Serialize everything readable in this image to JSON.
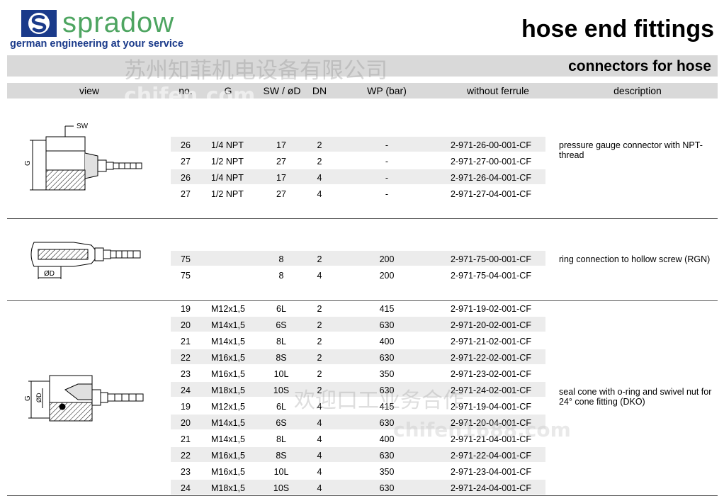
{
  "brand": {
    "name": "spradow",
    "tagline": "german engineering at your service"
  },
  "title": "hose end fittings",
  "subtitle": "connectors for hose",
  "watermark": {
    "cn1": "苏州知菲机电设备有限公司",
    "latin1": "chifen.com",
    "cn2": "欢迎口工业务合作",
    "latin2": "chifen1688.com"
  },
  "columns": [
    "view",
    "no.",
    "G",
    "SW / øD",
    "DN",
    "WP (bar)",
    "without ferrule",
    "description"
  ],
  "drawing_labels": {
    "sw": "SW",
    "g": "G",
    "od": "ØD"
  },
  "groups": [
    {
      "description": "pressure gauge connector with NPT-thread",
      "rows": [
        {
          "no": "26",
          "g": "1/4 NPT",
          "sw": "17",
          "dn": "2",
          "wp": "-",
          "part": "2-971-26-00-001-CF"
        },
        {
          "no": "27",
          "g": "1/2 NPT",
          "sw": "27",
          "dn": "2",
          "wp": "-",
          "part": "2-971-27-00-001-CF"
        },
        {
          "no": "26",
          "g": "1/4 NPT",
          "sw": "17",
          "dn": "4",
          "wp": "-",
          "part": "2-971-26-04-001-CF"
        },
        {
          "no": "27",
          "g": "1/2 NPT",
          "sw": "27",
          "dn": "4",
          "wp": "-",
          "part": "2-971-27-04-001-CF"
        }
      ]
    },
    {
      "description": "ring connection to hollow screw (RGN)",
      "rows": [
        {
          "no": "75",
          "g": "",
          "sw": "8",
          "dn": "2",
          "wp": "200",
          "part": "2-971-75-00-001-CF"
        },
        {
          "no": "75",
          "g": "",
          "sw": "8",
          "dn": "4",
          "wp": "200",
          "part": "2-971-75-04-001-CF"
        }
      ]
    },
    {
      "description": "seal cone with o-ring and swivel nut for 24° cone fitting (DKO)",
      "rows": [
        {
          "no": "19",
          "g": "M12x1,5",
          "sw": "6L",
          "dn": "2",
          "wp": "415",
          "part": "2-971-19-02-001-CF"
        },
        {
          "no": "20",
          "g": "M14x1,5",
          "sw": "6S",
          "dn": "2",
          "wp": "630",
          "part": "2-971-20-02-001-CF"
        },
        {
          "no": "21",
          "g": "M14x1,5",
          "sw": "8L",
          "dn": "2",
          "wp": "400",
          "part": "2-971-21-02-001-CF"
        },
        {
          "no": "22",
          "g": "M16x1,5",
          "sw": "8S",
          "dn": "2",
          "wp": "630",
          "part": "2-971-22-02-001-CF"
        },
        {
          "no": "23",
          "g": "M16x1,5",
          "sw": "10L",
          "dn": "2",
          "wp": "350",
          "part": "2-971-23-02-001-CF"
        },
        {
          "no": "24",
          "g": "M18x1,5",
          "sw": "10S",
          "dn": "2",
          "wp": "630",
          "part": "2-971-24-02-001-CF"
        },
        {
          "no": "19",
          "g": "M12x1,5",
          "sw": "6L",
          "dn": "4",
          "wp": "415",
          "part": "2-971-19-04-001-CF"
        },
        {
          "no": "20",
          "g": "M14x1,5",
          "sw": "6S",
          "dn": "4",
          "wp": "630",
          "part": "2-971-20-04-001-CF"
        },
        {
          "no": "21",
          "g": "M14x1,5",
          "sw": "8L",
          "dn": "4",
          "wp": "400",
          "part": "2-971-21-04-001-CF"
        },
        {
          "no": "22",
          "g": "M16x1,5",
          "sw": "8S",
          "dn": "4",
          "wp": "630",
          "part": "2-971-22-04-001-CF"
        },
        {
          "no": "23",
          "g": "M16x1,5",
          "sw": "10L",
          "dn": "4",
          "wp": "350",
          "part": "2-971-23-04-001-CF"
        },
        {
          "no": "24",
          "g": "M18x1,5",
          "sw": "10S",
          "dn": "4",
          "wp": "630",
          "part": "2-971-24-04-001-CF"
        }
      ]
    }
  ],
  "colors": {
    "brand_green": "#4ea561",
    "brand_blue": "#1a3a8a",
    "band_gray": "#d9d9d9",
    "stripe_gray": "#ececec"
  }
}
